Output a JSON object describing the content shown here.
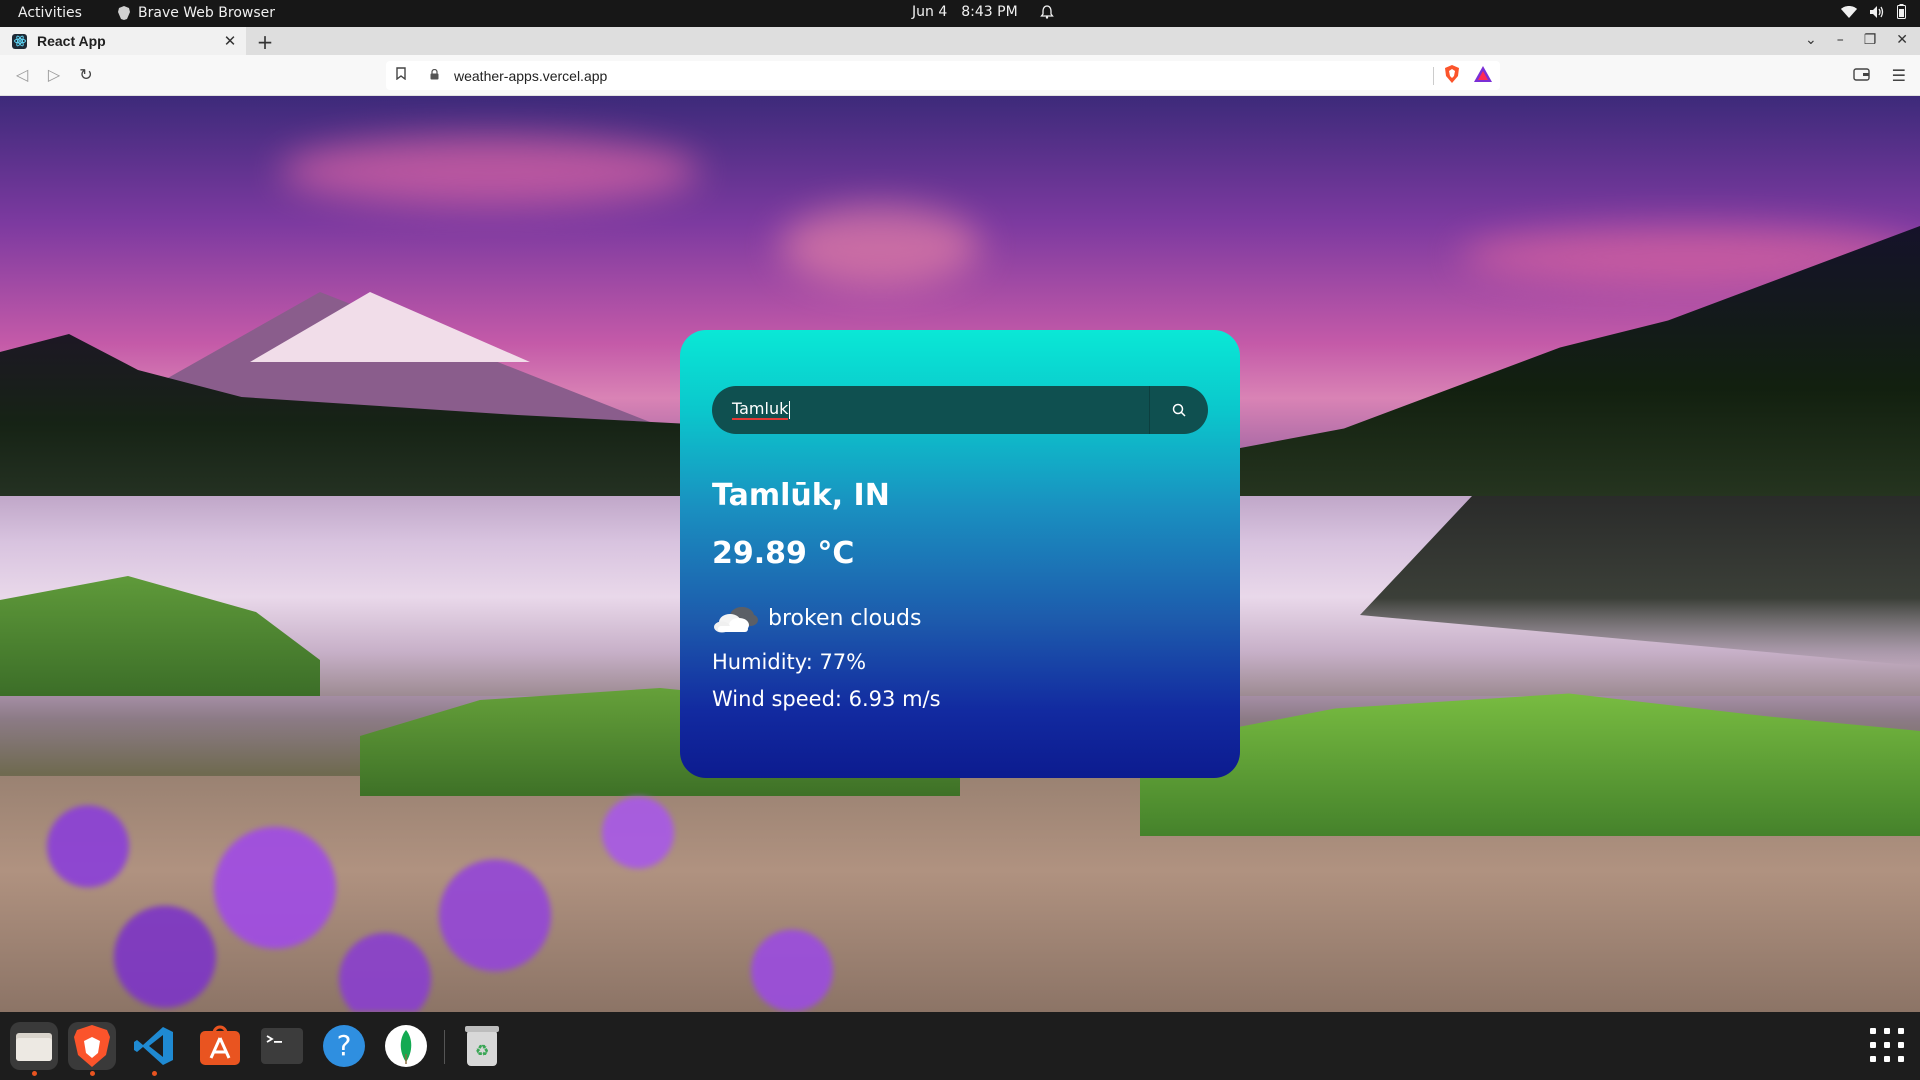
{
  "topbar": {
    "activities": "Activities",
    "app_name": "Brave Web Browser",
    "date": "Jun 4",
    "time": "8:43 PM"
  },
  "browser": {
    "tab_title": "React App",
    "new_tab": "+",
    "url": "weather-apps.vercel.app"
  },
  "weather": {
    "search_value": "Tamluk",
    "city": "Tamlūk, IN",
    "temperature": "29.89 °C",
    "description": "broken clouds",
    "humidity": "Humidity: 77%",
    "wind": "Wind speed: 6.93 m/s",
    "icon": "broken-clouds-icon"
  },
  "dock": {
    "apps": [
      "files-icon",
      "brave-browser-icon",
      "vscode-icon",
      "software-center-icon",
      "terminal-icon",
      "help-icon",
      "mongodb-compass-icon",
      "trash-icon"
    ]
  },
  "colors": {
    "card_top": "#0ae8d6",
    "card_bottom": "#0c1b8f",
    "search_bg": "#0f5050",
    "accent": "#e95420"
  }
}
